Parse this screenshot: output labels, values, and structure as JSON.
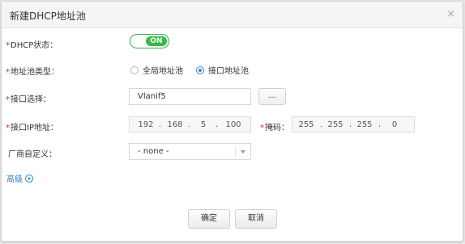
{
  "dialog": {
    "title": "新建DHCP地址池",
    "close_glyph": "×"
  },
  "form": {
    "required_mark": "*",
    "dhcp_status": {
      "label": "DHCP状态：",
      "value": "ON"
    },
    "pool_type": {
      "label": "地址池类型：",
      "options": [
        "全局地址池",
        "接口地址池"
      ],
      "selected": "接口地址池"
    },
    "interface": {
      "label": "接口选择：",
      "value": "Vlanif5",
      "browse_label": "..."
    },
    "interface_ip": {
      "label": "接口IP地址：",
      "octets": [
        "192",
        "168",
        "5",
        "100"
      ],
      "separator": "."
    },
    "mask": {
      "label": "掩码：",
      "octets": [
        "255",
        "255",
        "255",
        "0"
      ],
      "separator": "."
    },
    "vendor": {
      "label": "厂商自定义：",
      "value": "- none -"
    },
    "advanced": {
      "label": "高级"
    }
  },
  "footer": {
    "confirm_label": "确定",
    "cancel_label": "取消"
  },
  "colors": {
    "accent": "#3cb54a",
    "link": "#2a7fd4",
    "required": "#e02020"
  }
}
